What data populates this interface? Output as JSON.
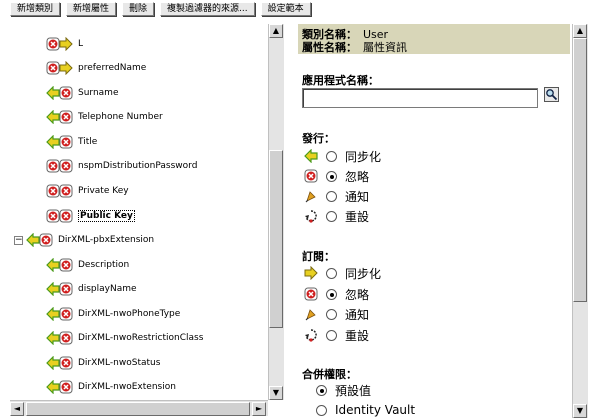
{
  "toolbar": {
    "buttons": [
      "新增類別",
      "新增屬性",
      "刪除",
      "複製過濾器的來源...",
      "設定範本"
    ]
  },
  "tree": {
    "items": [
      {
        "label": "L",
        "icons": "sync-ignore",
        "selected": false
      },
      {
        "label": "preferredName",
        "icons": "sync-ignore",
        "selected": false
      },
      {
        "label": "Surname",
        "icons": "sync-ignore",
        "selected": false
      },
      {
        "label": "Telephone Number",
        "icons": "sync-ignore",
        "selected": false
      },
      {
        "label": "Title",
        "icons": "sync-ignore",
        "selected": false
      },
      {
        "label": "nspmDistributionPassword",
        "icons": "ignore-ignore",
        "selected": false
      },
      {
        "label": "Private Key",
        "icons": "ignore-ignore",
        "selected": false
      },
      {
        "label": "Public Key",
        "icons": "ignore-ignore",
        "selected": true
      }
    ],
    "class_node": {
      "label": "DirXML-pbxExtension",
      "expander": "−"
    },
    "class_items": [
      {
        "label": "Description"
      },
      {
        "label": "displayName"
      },
      {
        "label": "DirXML-nwoPhoneType"
      },
      {
        "label": "DirXML-nwoRestrictionClass"
      },
      {
        "label": "DirXML-nwoStatus"
      },
      {
        "label": "DirXML-nwoExtension"
      }
    ]
  },
  "details": {
    "class_name_label": "類別名稱：",
    "class_name_value": "User",
    "attr_name_label": "屬性名稱：",
    "attr_name_value": "屬性資訊",
    "app_name_label": "應用程式名稱：",
    "app_name_value": "",
    "publish_label": "發行：",
    "publish_options": [
      {
        "label": "同步化",
        "icon": "sync-icon",
        "checked": false
      },
      {
        "label": "忽略",
        "icon": "ignore-icon",
        "checked": true
      },
      {
        "label": "通知",
        "icon": "notify-icon",
        "checked": false
      },
      {
        "label": "重設",
        "icon": "reset-icon",
        "checked": false
      }
    ],
    "subscribe_label": "訂閱：",
    "subscribe_options": [
      {
        "label": "同步化",
        "icon": "sync-icon",
        "checked": false
      },
      {
        "label": "忽略",
        "icon": "ignore-icon",
        "checked": true
      },
      {
        "label": "通知",
        "icon": "notify-icon",
        "checked": false
      },
      {
        "label": "重設",
        "icon": "reset-icon",
        "checked": false
      }
    ],
    "merge_label": "合併權限：",
    "merge_options": [
      {
        "label": "預設值",
        "checked": true
      },
      {
        "label": "Identity Vault",
        "checked": false
      }
    ]
  },
  "colors": {
    "header_bg": "#d8d6b8",
    "sync_green": "#4a9a1a",
    "ignore_red": "#d02020",
    "arrow_yellow": "#e8d020"
  }
}
